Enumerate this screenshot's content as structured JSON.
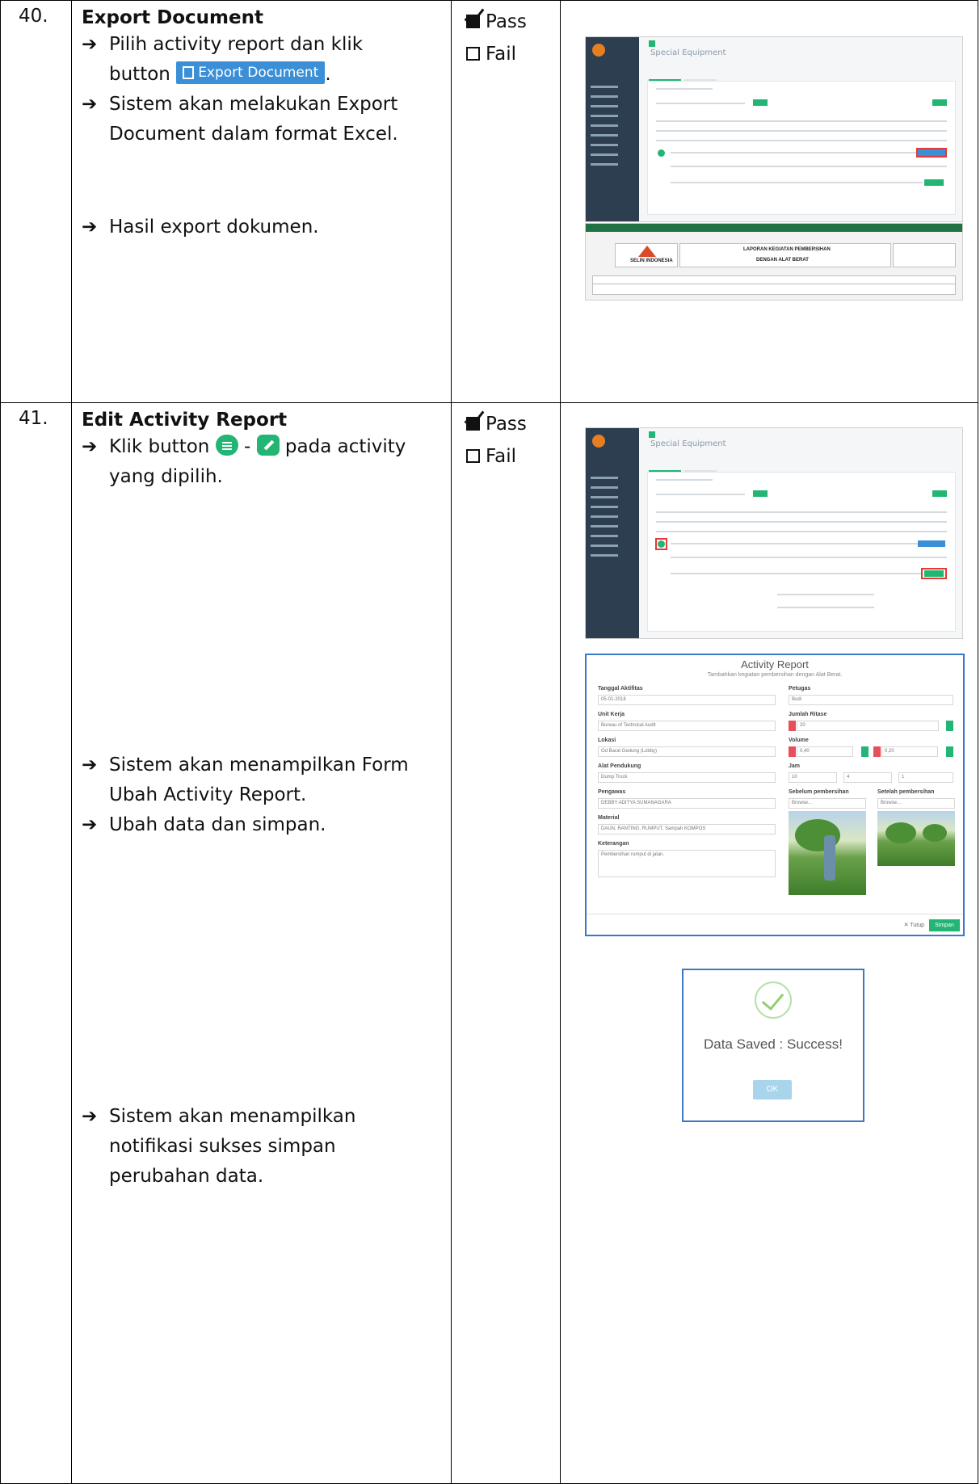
{
  "rows": [
    {
      "number": "40.",
      "title": "Export Document",
      "steps": [
        "Pilih activity report dan klik",
        "button",
        "Sistem akan melakukan Export Document dalam format Excel.",
        "Hasil export dokumen."
      ],
      "inline_button": "Export Document",
      "result": {
        "pass": "Pass",
        "fail": "Fail",
        "selected": "pass"
      }
    },
    {
      "number": "41.",
      "title": "Edit Activity Report",
      "steps": [
        "Klik button",
        "pada activity yang dipilih.",
        "Sistem akan menampilkan Form Ubah Activity Report.",
        "Ubah data dan simpan.",
        "Sistem akan menampilkan notifikasi sukses simpan perubahan data."
      ],
      "result": {
        "pass": "Pass",
        "fail": "Fail",
        "selected": "pass"
      }
    }
  ],
  "screens": {
    "app_title": "Special Equipment",
    "xl_title_1": "LAPORAN KEGIATAN PEMBERSIHAN",
    "xl_title_2": "DENGAN ALAT BERAT",
    "xl_logo": "SELIN INDONESIA",
    "form_title": "Activity Report",
    "form_subtitle": "Tambahkan kegiatan pembersihan dengan Alat Berat.",
    "form_labels": {
      "tanggal": "Tanggal Aktifitas",
      "petugas": "Petugas",
      "unit": "Unit Kerja",
      "jumlah": "Jumlah Ritase",
      "lokasi": "Lokasi",
      "volume": "Volume",
      "alat": "Alat Pendukung",
      "jam": "Jam",
      "pengawas": "Pengawas",
      "sebelum": "Sebelum pembersihan",
      "sesudah": "Setelah pembersihan",
      "material": "Material",
      "keterangan": "Keterangan"
    },
    "form_values": {
      "tanggal": "05-01-2018",
      "petugas": "Budi",
      "unit": "Bureau of Technical Audit",
      "jumlah": "20",
      "lokasi": "Gd Barat Gedung (Lobby)",
      "volume_1": "0,40",
      "volume_2": "0,20",
      "alat": "Dump Truck",
      "jam_1": "10",
      "jam_2": "4",
      "jam_3": "1",
      "pengawas": "DEBBY ADITYA SUMANAGARA",
      "browse": "Browse...",
      "material": "DAUN, RANTING, RUMPUT, Sampah KOMPOS",
      "keterangan": "Pembersihan rumput di jalan."
    },
    "close": "Tutup",
    "save": "Simpan",
    "success_text": "Data Saved : Success!",
    "ok": "OK"
  }
}
